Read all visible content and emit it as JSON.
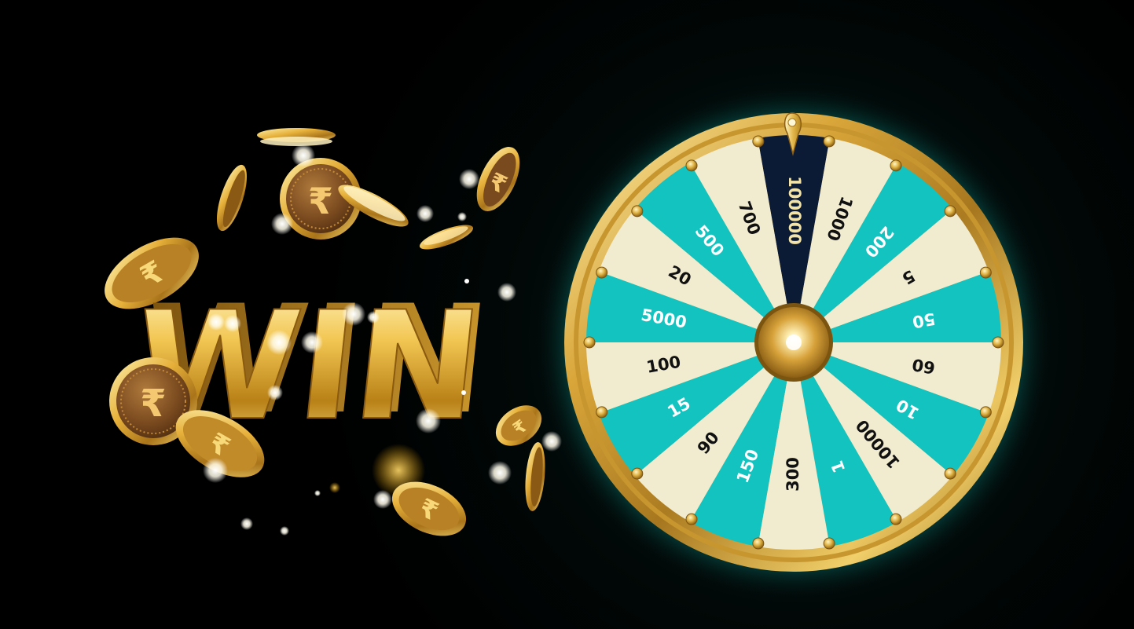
{
  "scene": {
    "banner_text": "WIN",
    "currency_symbol": "₹"
  },
  "wheel": {
    "segments": [
      {
        "label": "100000",
        "color": "dark"
      },
      {
        "label": "1000",
        "color": "cream"
      },
      {
        "label": "200",
        "color": "teal"
      },
      {
        "label": "5",
        "color": "cream"
      },
      {
        "label": "50",
        "color": "teal"
      },
      {
        "label": "60",
        "color": "cream"
      },
      {
        "label": "10",
        "color": "teal"
      },
      {
        "label": "10000",
        "color": "cream"
      },
      {
        "label": "1",
        "color": "teal"
      },
      {
        "label": "300",
        "color": "cream"
      },
      {
        "label": "150",
        "color": "teal"
      },
      {
        "label": "90",
        "color": "cream"
      },
      {
        "label": "15",
        "color": "teal"
      },
      {
        "label": "100",
        "color": "cream"
      },
      {
        "label": "5000",
        "color": "teal"
      },
      {
        "label": "20",
        "color": "cream"
      },
      {
        "label": "500",
        "color": "teal"
      },
      {
        "label": "700",
        "color": "cream"
      }
    ],
    "colors": {
      "teal": "#12c3c0",
      "cream": "#f1ecd0",
      "dark": "#0b1a35",
      "gold": "#e0b445",
      "glow": "#19d8c8",
      "label_on_teal": "#ffffff",
      "label_on_cream": "#111111",
      "label_on_dark": "#f3e3a6"
    }
  }
}
